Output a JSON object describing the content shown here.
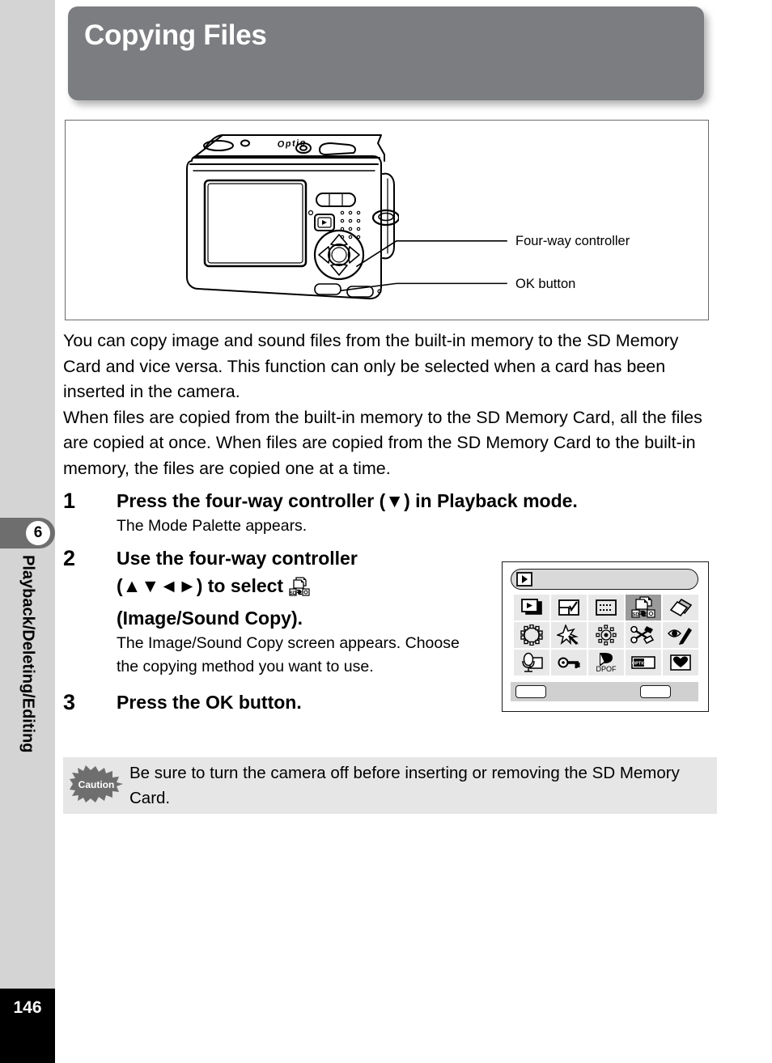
{
  "chapter": {
    "number": "6",
    "title": "Playback/Deleting/Editing",
    "page_number": "146"
  },
  "header": {
    "title": "Copying Files",
    "bar_color": "#7c7d80"
  },
  "figure": {
    "device_name": "Optio",
    "callouts": [
      {
        "label": "Four-way controller"
      },
      {
        "label": "OK button"
      }
    ]
  },
  "body": {
    "paragraph1": "You can copy image and sound files from the built-in memory to the SD Memory Card and vice versa. This function can only be selected when a card has been inserted in the camera.",
    "paragraph2": "When files are copied from the built-in memory to the SD Memory Card, all the files are copied at once. When files are copied from the SD Memory Card to the built-in memory, the files are copied one at a time."
  },
  "steps": [
    {
      "number": "1",
      "heading": "Press the four-way controller (▼) in Playback mode.",
      "body": "The Mode Palette appears."
    },
    {
      "number": "2",
      "heading_line1": "Use the four-way controller",
      "heading_line2": "(▲▼◄►) to select",
      "heading_line3": "(Image/Sound Copy).",
      "body": "The Image/Sound Copy screen appears. Choose the copying method you want to use."
    },
    {
      "number": "3",
      "heading": "Press the OK button.",
      "body": ""
    }
  ],
  "mode_palette": {
    "selected_index": 3,
    "selected_label": "Image/Sound Copy",
    "icons": [
      "slideshow-icon",
      "resize-icon",
      "crop-icon",
      "image-sound-copy-icon",
      "rotate-icon",
      "frame-composite-icon",
      "digital-filter-icon",
      "brightness-filter-icon",
      "red-eye-scissors-icon",
      "red-eye-pen-icon",
      "voice-memo-icon",
      "protect-key-icon",
      "dpof-icon",
      "startup-screen-icon",
      "favorite-heart-icon"
    ],
    "dpof_label": "DPOF",
    "startup_label": "OPTIO"
  },
  "caution": {
    "badge": "Caution",
    "text": "Be sure to turn the camera off before inserting or removing the SD Memory Card."
  }
}
